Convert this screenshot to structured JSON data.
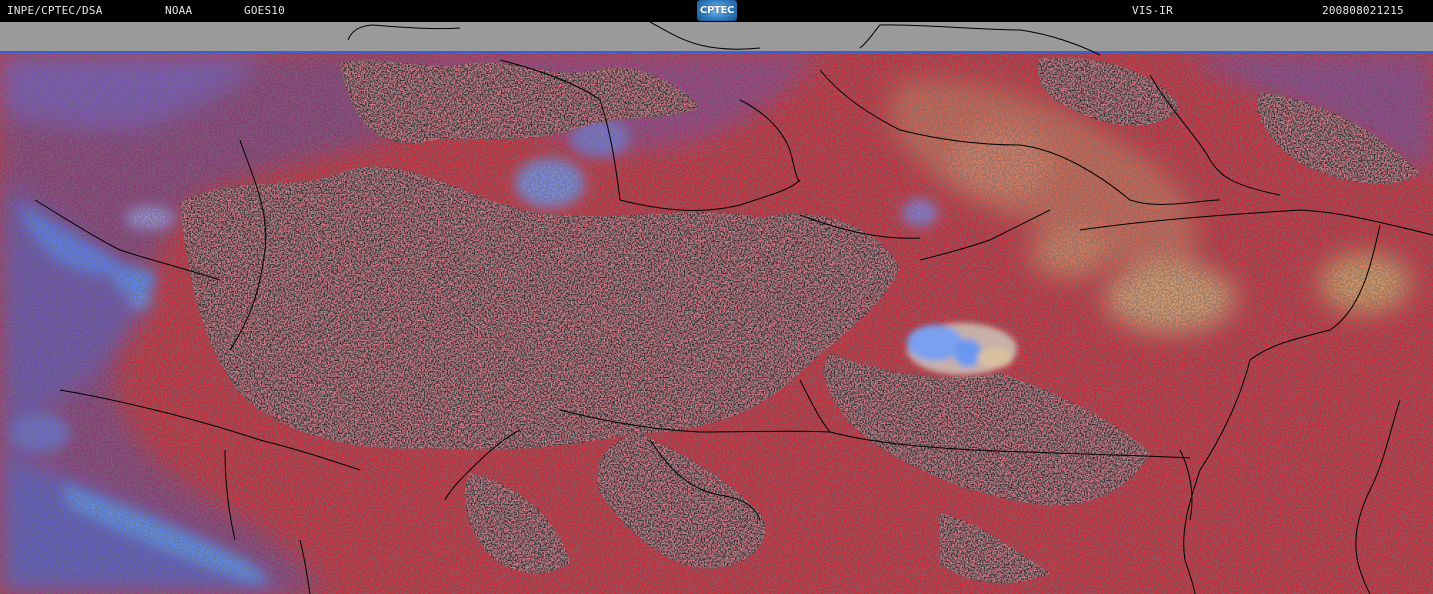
{
  "header": {
    "source": "INPE/CPTEC/DSA",
    "agency": "NOAA",
    "satellite": "GOES10",
    "channel": "VIS-IR",
    "datetime": "200808021215"
  },
  "logo": {
    "text": "CPTEC",
    "icon": "cptec-logo-icon"
  },
  "image": {
    "product": "satellite-composite",
    "palette": {
      "cloud_free_land": "#c82c3a",
      "bare_land_dark": "#2a2a2c",
      "low_cloud": "#8a3a78",
      "mid_cloud": "#6a4fb0",
      "high_cloud": "#5a8cf0",
      "bright_cloud": "#e0c070",
      "no_data": "#9a9a9a",
      "borders": "#000000",
      "edge_line": "#3a5fd6"
    }
  }
}
